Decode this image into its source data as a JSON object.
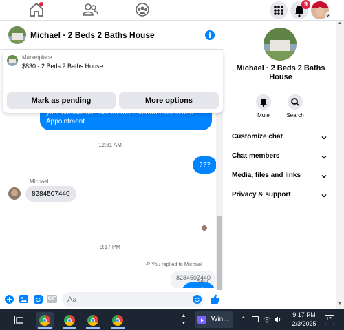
{
  "nav": {
    "icons": [
      "home-icon",
      "friends-icon",
      "groups-icon",
      "menu-grid-icon",
      "notifications-icon",
      "profile-avatar"
    ],
    "notification_count": "9"
  },
  "chat": {
    "header_title": "Michael · 2 Beds 2 Baths House",
    "marketplace": {
      "label": "Marketplace",
      "listing": "$830 - 2 Beds 2 Baths House",
      "mark_pending": "Mark as pending",
      "more_options": "More options"
    },
    "messages": {
      "msg1": "Yes this house is still available for rent , Send me your contact number for more informationan and Appointment",
      "time1": "12:31 AM",
      "msg2": "???",
      "sender_name": "Michael",
      "msg3": "8284507440",
      "time2": "9:17 PM",
      "replied_label": "You replied to Michael",
      "quoted": "8284507440",
      "msg4": "thanks",
      "status": "Sent"
    },
    "composer": {
      "placeholder": "Aa"
    }
  },
  "panel": {
    "title": "Michael · 2 Beds 2 Baths House",
    "mute_label": "Mute",
    "search_label": "Search",
    "items": [
      "Customize chat",
      "Chat members",
      "Media, files and links",
      "Privacy & support"
    ]
  },
  "taskbar": {
    "app_label": "Win...",
    "time": "9:17 PM",
    "date": "2/3/2025",
    "notif_count": "17"
  },
  "colors": {
    "accent": "#0084ff",
    "badge": "#e41e3f",
    "taskbar": "#1c2633"
  }
}
